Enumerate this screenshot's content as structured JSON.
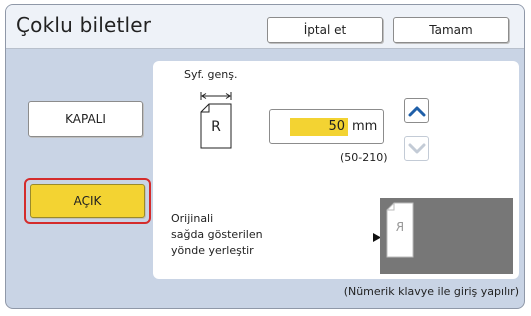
{
  "header": {
    "title": "Çoklu biletler",
    "cancel_label": "İptal et",
    "ok_label": "Tamam"
  },
  "mode": {
    "off_label": "KAPALI",
    "on_label": "AÇIK",
    "selected": "on"
  },
  "page_width": {
    "label": "Syf. genş.",
    "icon_letter": "R",
    "value": "50",
    "unit": "mm",
    "range": "(50-210)"
  },
  "placement": {
    "lines": [
      "Orijinali",
      "sağda gösterilen",
      "yönde yerleştir"
    ],
    "preview_letter": "R"
  },
  "footnote": "(Nümerik klavye ile giriş yapılır)",
  "colors": {
    "accent": "#f3d332",
    "selection_outline": "#d42c2c",
    "up_arrow": "#1f5fa8",
    "background": "#c9d4e5"
  },
  "icons": {
    "up": "chevron-up-icon",
    "down": "chevron-down-icon",
    "play": "play-icon",
    "page": "document-icon"
  }
}
